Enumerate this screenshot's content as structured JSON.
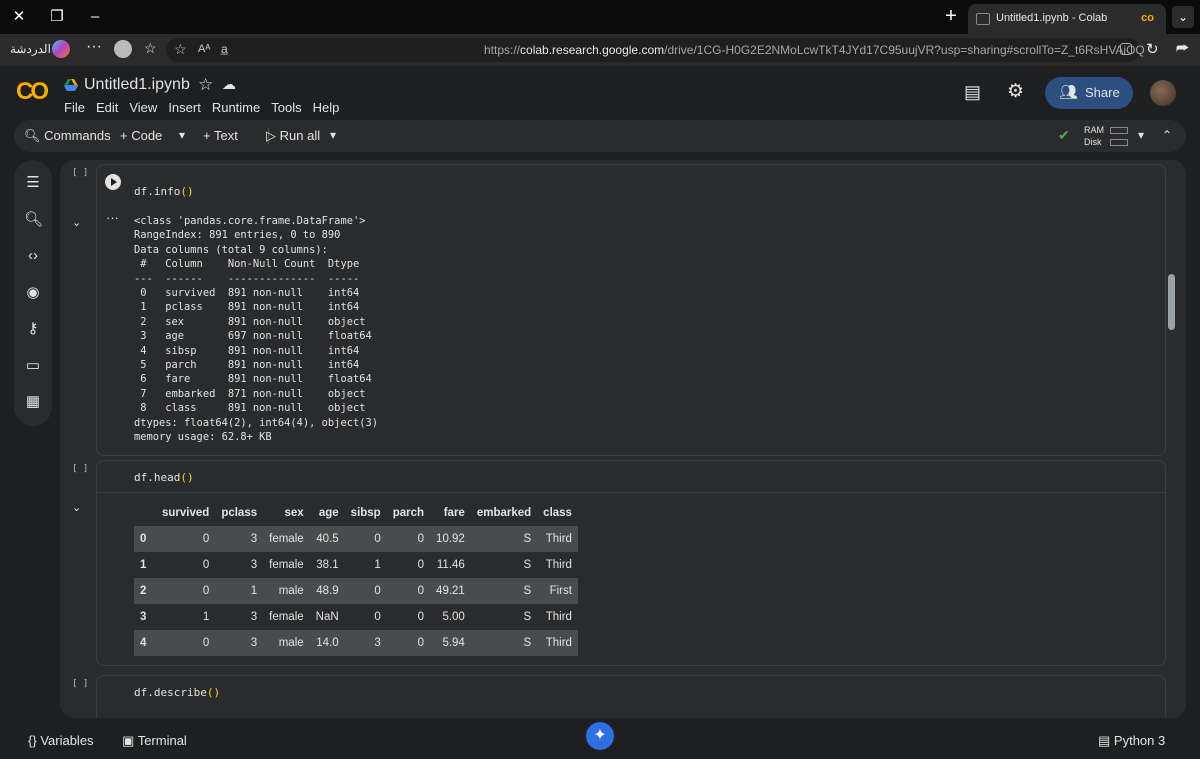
{
  "browser": {
    "tab_title": "Untitled1.ipynb - Colab",
    "tab_icon": "co",
    "addr_label": "الدردشة",
    "url_prefix": "https://",
    "url_domain": "colab.research.google.com",
    "url_path": "/drive/1CG-H0G2E2NMoLcwTkT4JYd17C95uujVR?usp=sharing#scrollTo=Z_t6RsHVAiOQ"
  },
  "colab": {
    "logo": "CO",
    "notebook_title": "Untitled1.ipynb",
    "menu": [
      "File",
      "Edit",
      "View",
      "Insert",
      "Runtime",
      "Tools",
      "Help"
    ],
    "share_label": "Share",
    "toolbar": {
      "commands": "Commands",
      "code": "+ Code",
      "text": "+ Text",
      "run_all": "Run all",
      "ram": "RAM",
      "disk": "Disk"
    }
  },
  "cells": {
    "info": {
      "bracket": "[ ]",
      "code_fn": "df.info",
      "code_paren": "()",
      "output": "<class 'pandas.core.frame.DataFrame'>\nRangeIndex: 891 entries, 0 to 890\nData columns (total 9 columns):\n #   Column    Non-Null Count  Dtype  \n---  ------    --------------  -----  \n 0   survived  891 non-null    int64  \n 1   pclass    891 non-null    int64  \n 2   sex       891 non-null    object \n 3   age       697 non-null    float64\n 4   sibsp     891 non-null    int64  \n 5   parch     891 non-null    int64  \n 6   fare      891 non-null    float64\n 7   embarked  871 non-null    object \n 8   class     891 non-null    object \ndtypes: float64(2), int64(4), object(3)\nmemory usage: 62.8+ KB"
    },
    "head": {
      "bracket": "[ ]",
      "code_fn": "df.head",
      "code_paren": "()",
      "columns": [
        "",
        "survived",
        "pclass",
        "sex",
        "age",
        "sibsp",
        "parch",
        "fare",
        "embarked",
        "class"
      ],
      "rows": [
        [
          "0",
          "0",
          "3",
          "female",
          "40.5",
          "0",
          "0",
          "10.92",
          "S",
          "Third"
        ],
        [
          "1",
          "0",
          "3",
          "female",
          "38.1",
          "1",
          "0",
          "11.46",
          "S",
          "Third"
        ],
        [
          "2",
          "0",
          "1",
          "male",
          "48.9",
          "0",
          "0",
          "49.21",
          "S",
          "First"
        ],
        [
          "3",
          "1",
          "3",
          "female",
          "NaN",
          "0",
          "0",
          "5.00",
          "S",
          "Third"
        ],
        [
          "4",
          "0",
          "3",
          "male",
          "14.0",
          "3",
          "0",
          "5.94",
          "S",
          "Third"
        ]
      ]
    },
    "describe": {
      "bracket": "[ ]",
      "code_fn": "df.describe",
      "code_paren": "()"
    }
  },
  "status": {
    "variables": "Variables",
    "terminal": "Terminal",
    "runtime": "Python 3"
  },
  "colors": {
    "accent": "#f9ab00",
    "share_bg": "#2c4f7f",
    "gemini": "#2f6fe4"
  }
}
